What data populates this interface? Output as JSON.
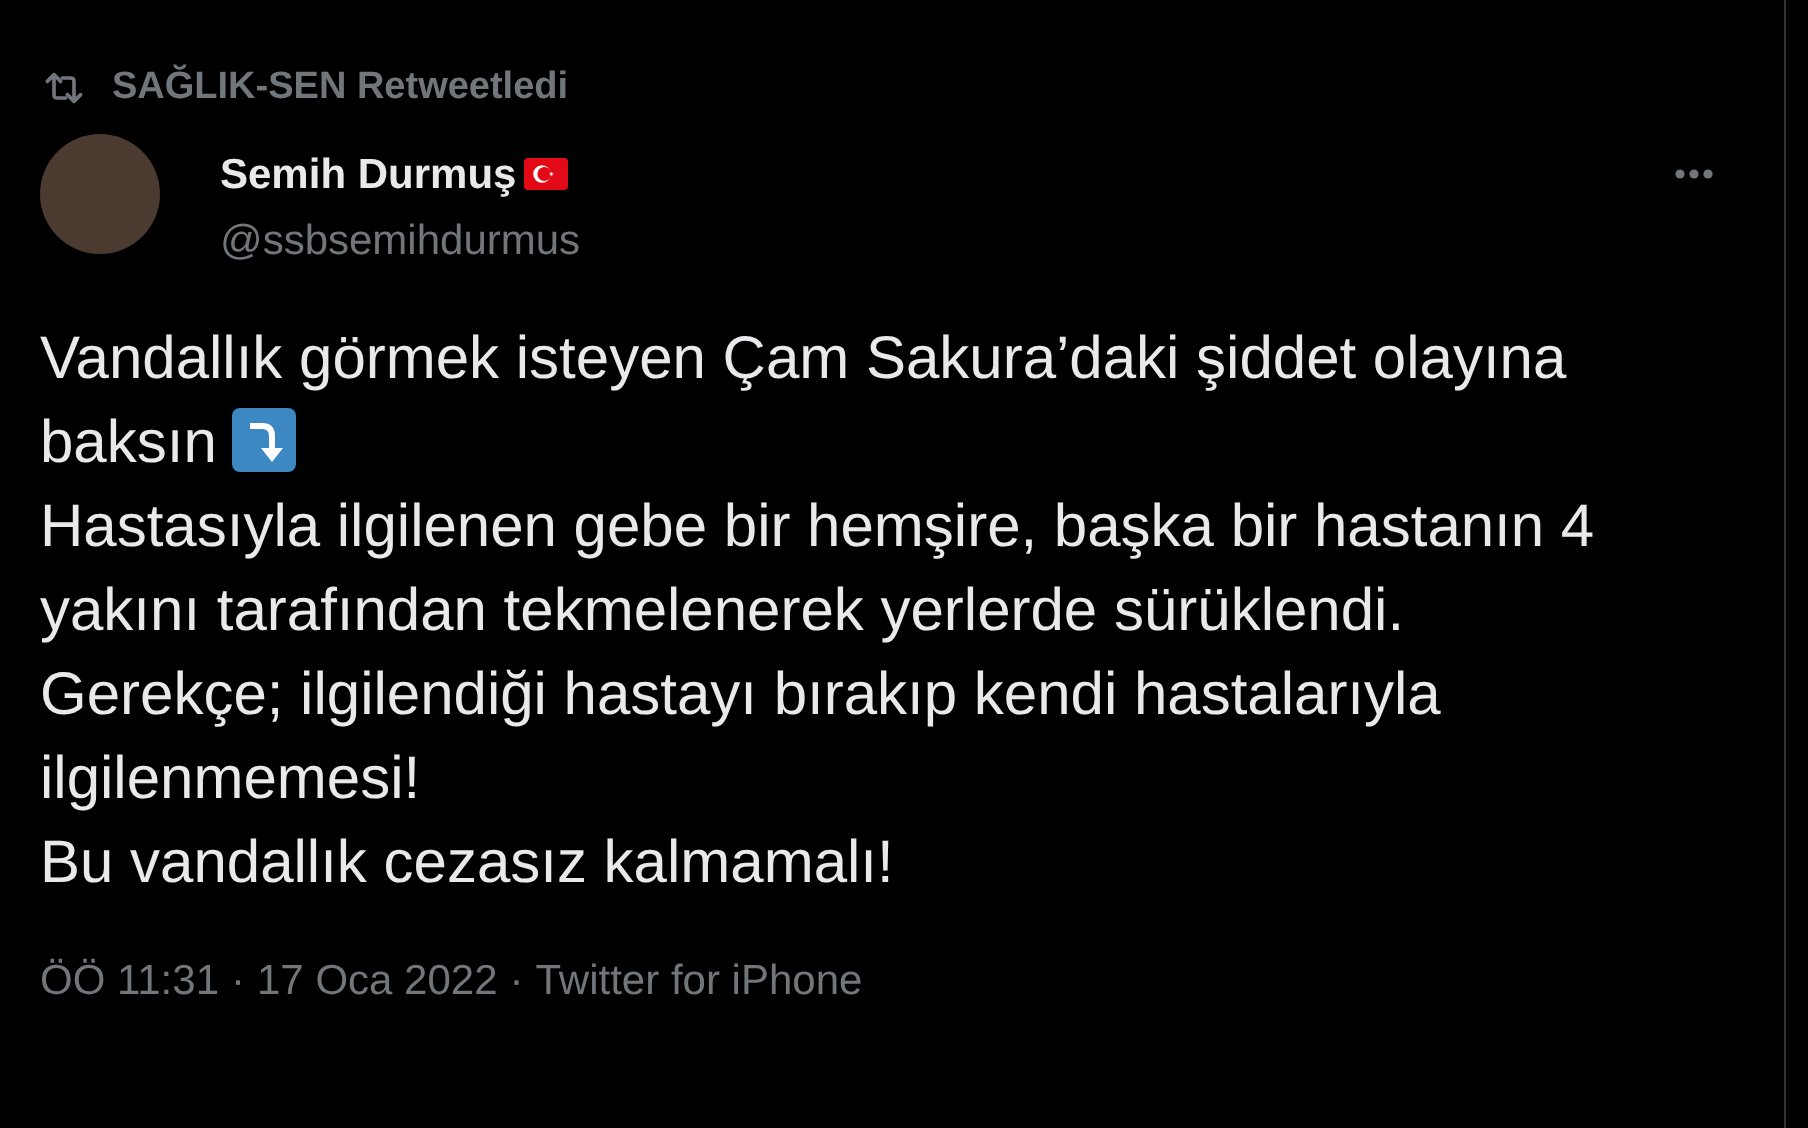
{
  "retweet": {
    "label": "SAĞLIK-SEN Retweetledi"
  },
  "author": {
    "name": "Semih Durmuş",
    "handle": "@ssbsemihdurmus"
  },
  "body": [
    {
      "text": "Vandallık görmek isteyen Çam Sakura’daki şiddet olayına baksın",
      "kind": "arrow"
    },
    {
      "text": "Hastasıyla ilgilenen gebe bir hemşire, başka bir hastanın 4 yakını tarafından tekmelenerek yerlerde sürüklendi.",
      "kind": "plain"
    },
    {
      "text": "Gerekçe; ilgilendiği hastayı bırakıp kendi hastalarıyla ilgilenmemesi!",
      "kind": "plain"
    },
    {
      "text": "Bu vandallık cezasız kalmamalı!",
      "kind": "plain"
    }
  ],
  "meta": {
    "time": "ÖÖ 11:31",
    "separator_1": "·",
    "date": "17 Oca 2022",
    "separator_2": "·",
    "source": "Twitter for iPhone"
  }
}
